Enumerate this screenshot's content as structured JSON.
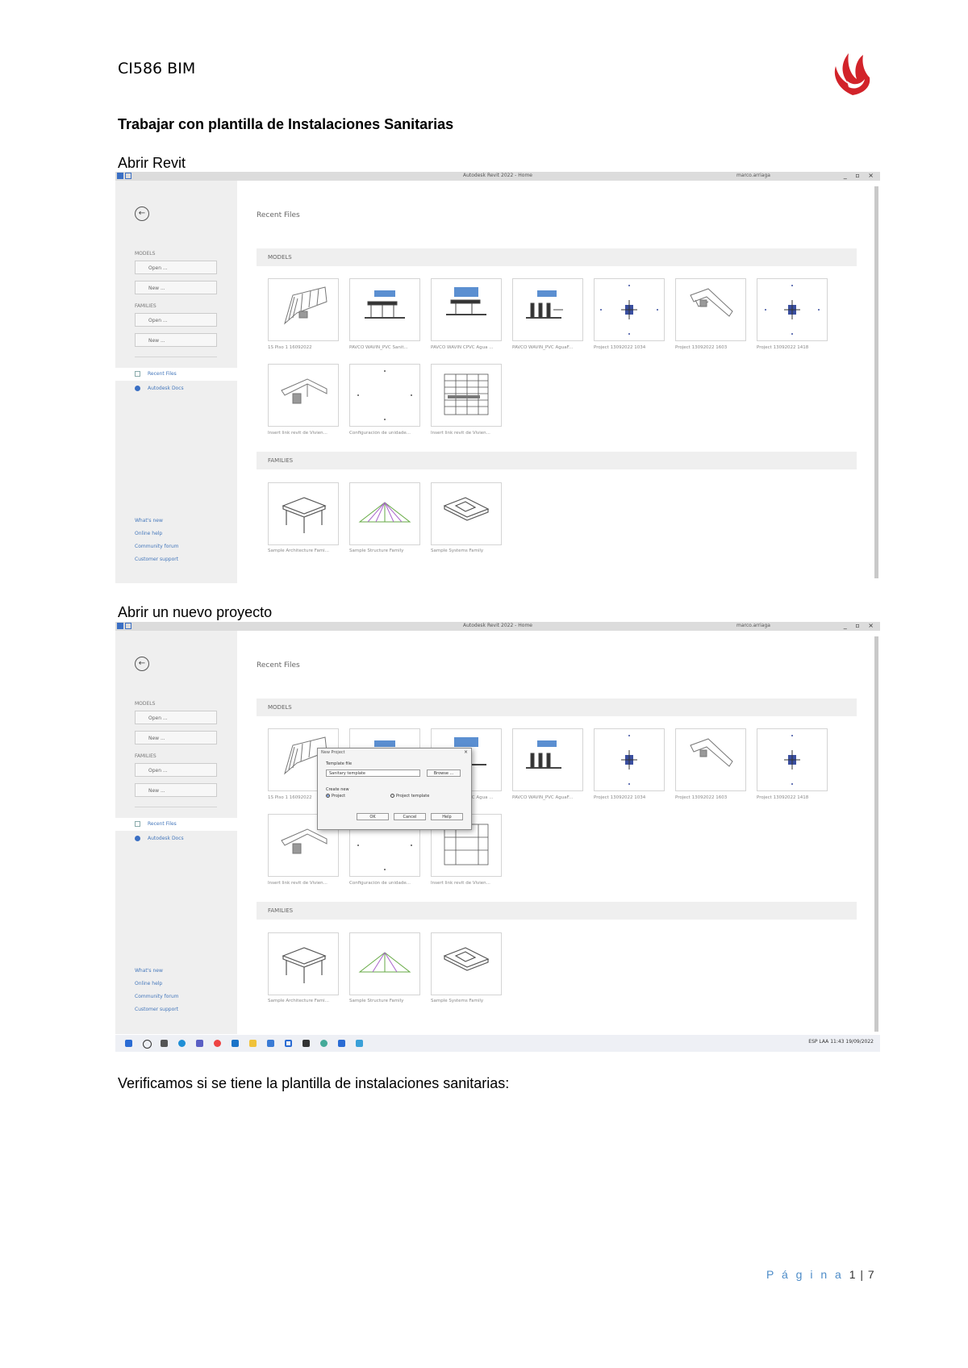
{
  "header": {
    "course_code": "CI586 BIM"
  },
  "title": "Trabajar con plantilla de Instalaciones Sanitarias",
  "captions": {
    "first": "Abrir Revit",
    "second": "Abrir un nuevo proyecto",
    "third": "Verificamos si se tiene la plantilla de instalaciones sanitarias:"
  },
  "revit": {
    "window_title": "Autodesk Revit 2022 - Home",
    "user_label": "marco.arriaga",
    "recent_files": "Recent Files",
    "sidebar": {
      "models": "MODELS",
      "families": "FAMILIES",
      "open": "Open ...",
      "new": "New ...",
      "recent_files": "Recent Files",
      "autodesk_docs": "Autodesk Docs",
      "links": [
        "What's new",
        "Online help",
        "Community forum",
        "Customer support"
      ]
    },
    "models_header": "MODELS",
    "families_header": "FAMILIES",
    "models": [
      "1S Piso 1 16092022",
      "PAVCO WAVIN_PVC Sanit...",
      "PAVCO WAVIN CPVC Agua ...",
      "PAVCO WAVIN_PVC AguaF...",
      "Project 13092022 1034",
      "Project 13092022 1603",
      "Project 13092022 1418",
      "Insert link revit de Vivien...",
      "Configuración de unidade...",
      "Insert link revit de Vivien..."
    ],
    "families": [
      "Sample Architecture Fami...",
      "Sample Structure Family",
      "Sample Systems Family"
    ],
    "dialog": {
      "title": "New Project",
      "template_file": "Template file",
      "template_value": "Sanitary template",
      "browse": "Browse ...",
      "create_new": "Create new",
      "project": "Project",
      "project_template": "Project template",
      "ok": "OK",
      "cancel": "Cancel",
      "help": "Help"
    },
    "taskbar": {
      "lang": "ESP LAA",
      "time": "11:43",
      "date": "19/09/2022"
    }
  },
  "footer": {
    "pagina": "P á g i n a",
    "number": "1 | 7"
  },
  "colors": {
    "logo_red": "#d2232a",
    "footer_blue": "#4d8cc8",
    "revit_blue": "#3a6fc4"
  }
}
